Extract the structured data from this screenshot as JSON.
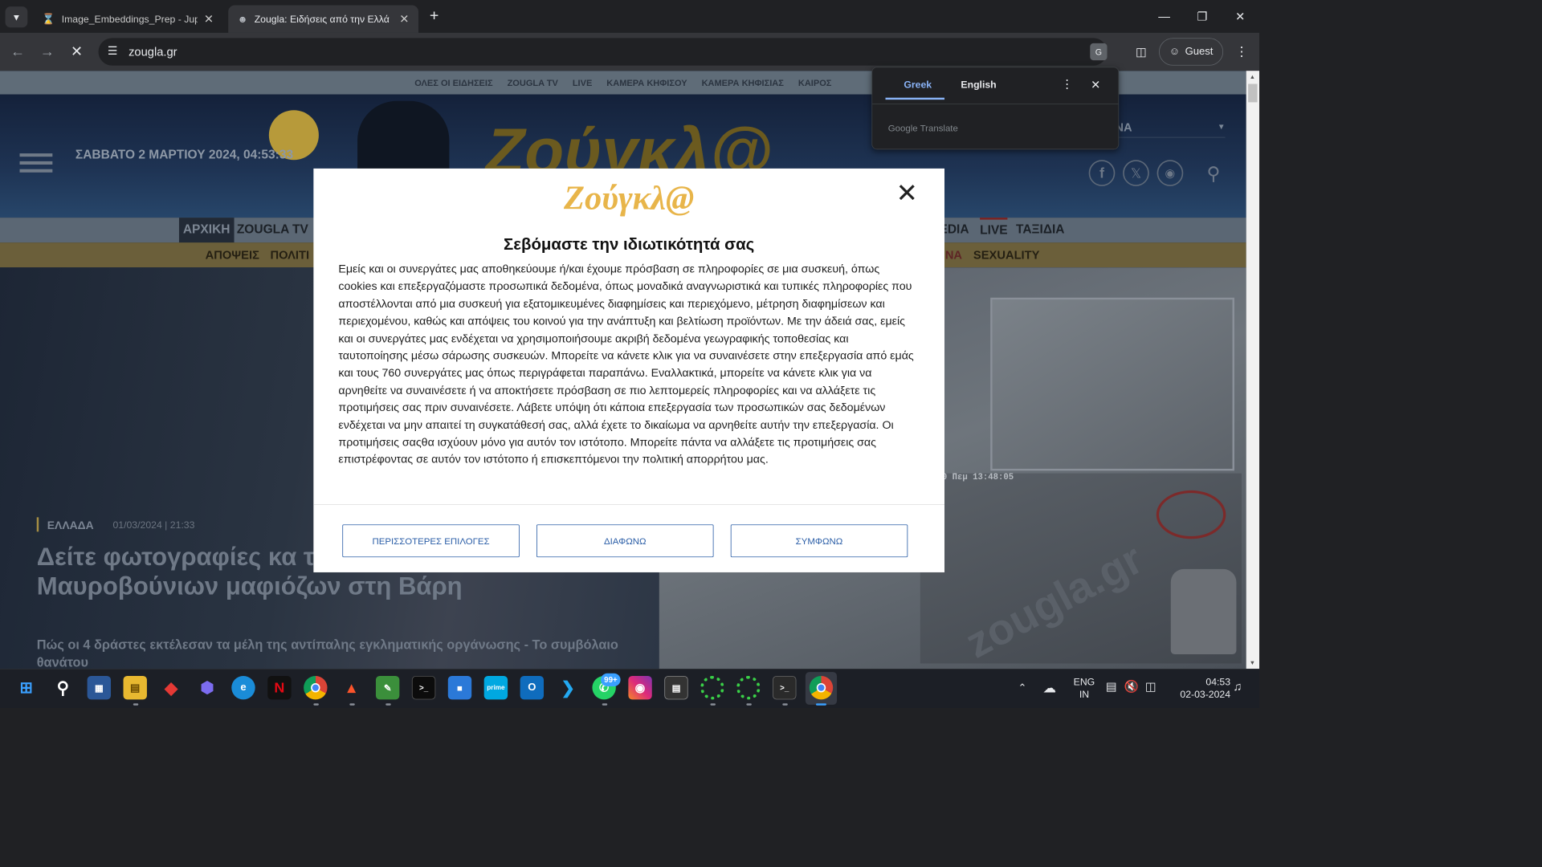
{
  "browser": {
    "tabs": [
      {
        "title": "Image_Embeddings_Prep - Jupy",
        "icon": "hourglass-icon"
      },
      {
        "title": "Zougla: Ειδήσεις από την Ελλά",
        "icon": "zougla-icon"
      }
    ],
    "url": "zougla.gr",
    "profile_label": "Guest"
  },
  "translate_popup": {
    "lang_source": "Greek",
    "lang_target": "English",
    "provider": "Google Translate",
    "partial_text": "NA"
  },
  "site": {
    "top_nav": [
      "ΟΛΕΣ ΟΙ ΕΙΔΗΣΕΙΣ",
      "ZOUGLA TV",
      "LIVE",
      "ΚΑΜΕΡΑ ΚΗΦΙΣΟΥ",
      "ΚΑΜΕΡΑ ΚΗΦΙΣΙΑΣ",
      "ΚΑΙΡΟΣ"
    ],
    "date_time": "ΣΑΒΒΑΤΟ 2 ΜΑΡΤΙΟΥ 2024, 04:53:33",
    "logo": "Ζούγκλ@",
    "main_nav_left": [
      "ΑΡΧΙΚΗ",
      "ZOUGLA TV"
    ],
    "main_nav_right": [
      "EDIA",
      "LIVE",
      "ΤΑΞΙΔΙΑ"
    ],
    "sub_nav_left": [
      "ΑΠΟΨΕΙΣ",
      "ΠΟΛΙΤΙ"
    ],
    "sub_nav_right": [
      "NA",
      "SEXUALITY"
    ],
    "article": {
      "category": "ΕΛΛΑΔΑ",
      "date": "01/03/2024 | 21:33",
      "headline": "Δείτε φωτογραφίες κα την επίθεση των Μαυροβούνιων μαφιόζων στη Βάρη",
      "subtitle": "Πώς οι 4 δράστες εκτέλεσαν τα μέλη της αντίπαλης εγκληματικής οργάνωσης - Το συμβόλαιο θανάτου"
    },
    "cam_timestamp": "-2020 Πεμ 13:48:05",
    "watermark": "zougla.gr"
  },
  "modal": {
    "logo": "Ζούγκλ@",
    "title": "Σεβόμαστε την ιδιωτικότητά σας",
    "body": "Εμείς και οι συνεργάτες μας αποθηκεύουμε ή/και έχουμε πρόσβαση σε πληροφορίες σε μια συσκευή, όπως cookies και επεξεργαζόμαστε προσωπικά δεδομένα, όπως μοναδικά αναγνωριστικά και τυπικές πληροφορίες που αποστέλλονται από μια συσκευή για εξατομικευμένες διαφημίσεις και περιεχόμενο, μέτρηση διαφημίσεων και περιεχομένου, καθώς και απόψεις του κοινού για την ανάπτυξη και βελτίωση προϊόντων. Με την άδειά σας, εμείς και οι συνεργάτες μας ενδέχεται να χρησιμοποιήσουμε ακριβή δεδομένα γεωγραφικής τοποθεσίας και ταυτοποίησης μέσω σάρωσης συσκευών. Μπορείτε να κάνετε κλικ για να συναινέσετε στην επεξεργασία από εμάς και τους 760 συνεργάτες μας όπως περιγράφεται παραπάνω. Εναλλακτικά, μπορείτε να κάνετε κλικ για να αρνηθείτε να συναινέσετε ή να αποκτήσετε πρόσβαση σε πιο λεπτομερείς πληροφορίες και να αλλάξετε τις προτιμήσεις σας πριν συναινέσετε. Λάβετε υπόψη ότι κάποια επεξεργασία των προσωπικών σας δεδομένων ενδέχεται να μην απαιτεί τη συγκατάθεσή σας, αλλά έχετε το δικαίωμα να αρνηθείτε αυτήν την επεξεργασία. Οι προτιμήσεις σαςθα ισχύουν μόνο για αυτόν τον ιστότοπο. Μπορείτε πάντα να αλλάξετε τις προτιμήσεις σας επιστρέφοντας σε αυτόν τον ιστότοπο ή επισκεπτόμενοι την πολιτική απορρήτου μας.",
    "buttons": {
      "more": "ΠΕΡΙΣΣΟΤΕΡΕΣ ΕΠΙΛΟΓΕΣ",
      "disagree": "ΔΙΑΦΩΝΩ",
      "agree": "ΣΥΜΦΩΝΩ"
    }
  },
  "taskbar": {
    "language": "ENG",
    "region": "IN",
    "time": "04:53",
    "date": "02-03-2024",
    "whatsapp_badge": "99+"
  }
}
